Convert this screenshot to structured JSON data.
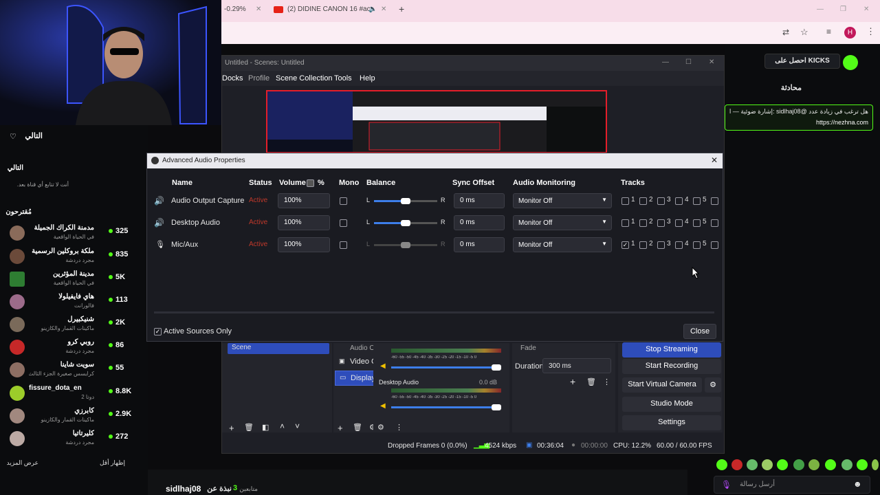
{
  "browser": {
    "tab1_text": "-0.29%",
    "tab2_text": "(2) DIDINE CANON 16 #acc",
    "avatar_letter": "H"
  },
  "sidebar": {
    "following_title": "التالي",
    "following_header": "التالي",
    "following_empty": "أنت لا تتابع أي قناة بعد.",
    "recommended_header": "مُقترحون",
    "channels": [
      {
        "name": "مدمنة الكراك الجميلة",
        "category": "في الحياة الواقعية",
        "count": "325"
      },
      {
        "name": "ملكة بروكلين الرسمية",
        "category": "مجرد دردشة",
        "count": "835"
      },
      {
        "name": "مدينة المؤثرين",
        "category": "في الحياة الواقعية",
        "count": "5K"
      },
      {
        "name": "هاي فايفيلولا",
        "category": "فالورانت",
        "count": "113"
      },
      {
        "name": "شنيكبيرل",
        "category": "ماكينات القمار والكازينو",
        "count": "2K"
      },
      {
        "name": "روبي كرو",
        "category": "مجرد دردشة",
        "count": "86"
      },
      {
        "name": "سويت شاينا",
        "category": "كرايسس صغيرة الجزء الثالث",
        "count": "55"
      },
      {
        "name": "fissure_dota_en",
        "category": "دوتا 2",
        "count": "8.8K"
      },
      {
        "name": "كابرزي",
        "category": "ماكينات القمار والكازينو",
        "count": "2.9K"
      },
      {
        "name": "كليرتاتيا",
        "category": "مجرد دردشة",
        "count": "272"
      }
    ],
    "show_more": "عرض المزيد",
    "show_less": "إظهار أقل"
  },
  "obs": {
    "window_title": "Untitled - Scenes: Untitled",
    "menu": [
      "Docks",
      "Profile",
      "Scene Collection",
      "Tools",
      "Help"
    ],
    "sources": [
      {
        "label": "Audio Output Captu"
      },
      {
        "label": "Video Capture Dev"
      },
      {
        "label": "Display Capture"
      }
    ],
    "scene_label": "Scene",
    "mixer": {
      "desktop_audio_label": "Desktop Audio",
      "desktop_audio_db": "0.0 dB",
      "ticks": "-60 -55 -50 -45 -40 -35 -30 -25 -20 -15 -10 -5 0"
    },
    "transition": {
      "type": "Fade",
      "duration_label": "Duration",
      "duration_value": "300 ms"
    },
    "controls": [
      "Stop Streaming",
      "Start Recording",
      "Start Virtual Camera",
      "Studio Mode",
      "Settings"
    ],
    "status": {
      "dropped": "Dropped Frames 0 (0.0%)",
      "kbps": "4524 kbps",
      "live_time": "00:36:04",
      "rec_time": "00:00:00",
      "cpu": "CPU: 12.2%",
      "fps": "60.00 / 60.00 FPS"
    }
  },
  "dialog": {
    "title": "Advanced Audio Properties",
    "headers": {
      "name": "Name",
      "status": "Status",
      "volume": "Volume",
      "percent": "%",
      "mono": "Mono",
      "balance": "Balance",
      "sync": "Sync Offset",
      "monitoring": "Audio Monitoring",
      "tracks": "Tracks"
    },
    "balance_left": "L",
    "balance_right": "R",
    "track_numbers": [
      "1",
      "2",
      "3",
      "4",
      "5"
    ],
    "rows": [
      {
        "name": "Audio Output Capture",
        "status": "Active",
        "volume": "100%",
        "sync": "0 ms",
        "monitoring": "Monitor Off"
      },
      {
        "name": "Desktop Audio",
        "status": "Active",
        "volume": "100%",
        "sync": "0 ms",
        "monitoring": "Monitor Off"
      },
      {
        "name": "Mic/Aux",
        "status": "Active",
        "volume": "100%",
        "sync": "0 ms",
        "monitoring": "Monitor Off"
      }
    ],
    "active_only_label": "Active Sources Only",
    "close_label": "Close"
  },
  "chat": {
    "kicks_banner": "احصل على KICKS",
    "header": "محادثة",
    "pinned_user": "@sidlhaj08",
    "pinned_text": "هل ترغب في زيادة عدد @sidlhaj08 :إشارة ضوئية — المشاهدين؟ لنجعلك مشهورًا",
    "pinned_link": "https://nezhna.com",
    "input_placeholder": "أرسل رسالة"
  },
  "bottom": {
    "streamer": "sidlhaj08",
    "followers": "نبذة عن",
    "follow_count": "3",
    "follow_label": "متابعين"
  },
  "colors": {
    "kick_green": "#53fc18",
    "obs_red": "#e51e2a",
    "obs_blue": "#3d7eea",
    "active_red": "#c0392b"
  }
}
